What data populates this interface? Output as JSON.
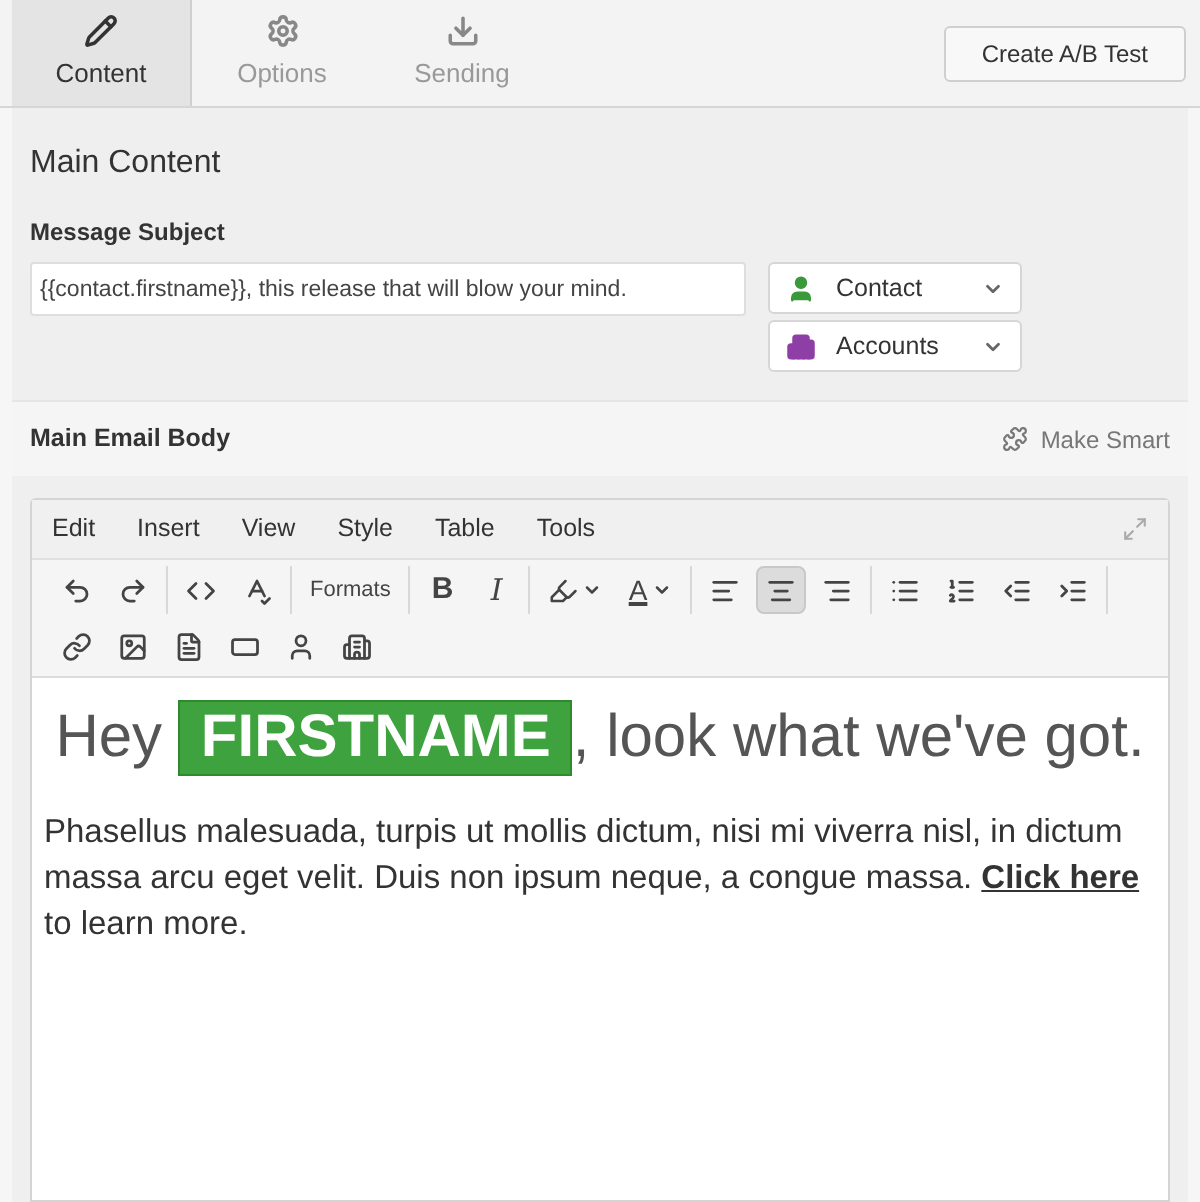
{
  "tabs": [
    {
      "label": "Content",
      "kind": "pencil",
      "selected": true
    },
    {
      "label": "Options",
      "kind": "gear",
      "selected": false
    },
    {
      "label": "Sending",
      "kind": "send",
      "selected": false
    }
  ],
  "ab_button": "Create A/B Test",
  "main_content": {
    "title": "Main Content",
    "subject_label": "Message Subject",
    "subject_value": "{{contact.firstname}}, this release that will blow your mind.",
    "dropdowns": [
      {
        "label": "Contact",
        "kind": "person",
        "color": "#3a9a3a"
      },
      {
        "label": "Accounts",
        "kind": "building",
        "color": "#8e3fa6"
      }
    ]
  },
  "email_body": {
    "title": "Main Email Body",
    "make_smart": "Make Smart",
    "menu": [
      "Edit",
      "Insert",
      "View",
      "Style",
      "Table",
      "Tools"
    ],
    "toolbar_rows": [
      [
        [
          {
            "kind": "undo"
          },
          {
            "kind": "redo"
          }
        ],
        [
          {
            "kind": "code"
          },
          {
            "kind": "spell"
          }
        ],
        [
          {
            "kind": "text",
            "label": "Formats"
          }
        ],
        [
          {
            "kind": "bold",
            "label": "B"
          },
          {
            "kind": "italic",
            "label": "I"
          }
        ],
        [
          {
            "kind": "bgcolor"
          },
          {
            "kind": "fontcolor",
            "label": "A"
          }
        ],
        [
          {
            "kind": "align-left",
            "selected": false
          },
          {
            "kind": "align-center",
            "selected": true
          },
          {
            "kind": "align-right",
            "selected": false
          }
        ],
        [
          {
            "kind": "bullets"
          },
          {
            "kind": "numbers"
          },
          {
            "kind": "outdent"
          },
          {
            "kind": "indent"
          }
        ]
      ],
      [
        [
          {
            "kind": "link"
          },
          {
            "kind": "image"
          },
          {
            "kind": "document"
          },
          {
            "kind": "field"
          },
          {
            "kind": "person"
          },
          {
            "kind": "building"
          }
        ]
      ]
    ],
    "heading": {
      "before": "Hey",
      "token": "FIRSTNAME",
      "after": ", look what we've got."
    },
    "paragraph": {
      "before": "Phasellus malesuada, turpis ut mollis dictum, nisi mi viverra nisl, in dictum massa arcu eget velit. Duis non ipsum neque, a congue massa. ",
      "link": "Click here",
      "after": " to learn more."
    }
  }
}
